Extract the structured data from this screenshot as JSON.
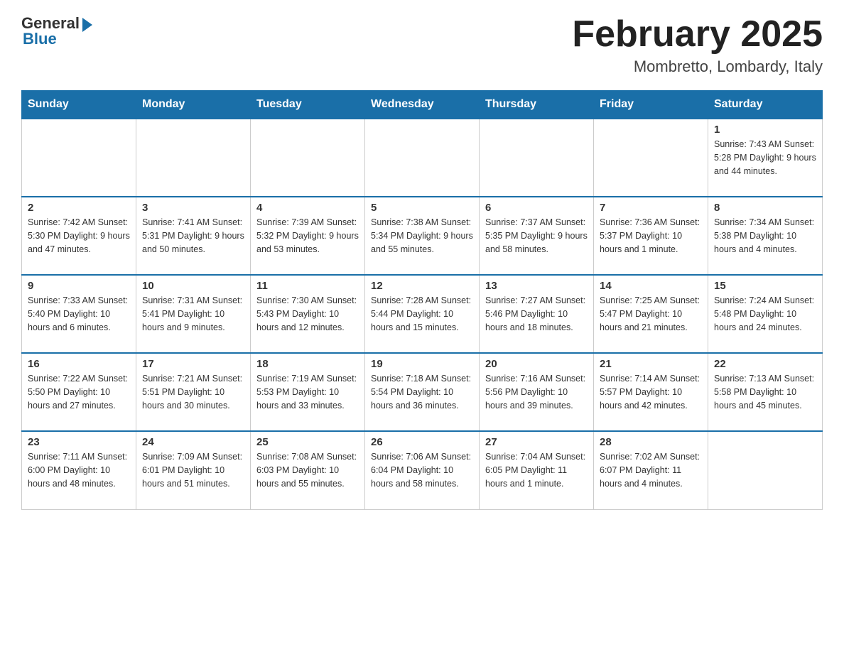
{
  "logo": {
    "general": "General",
    "blue": "Blue"
  },
  "title": "February 2025",
  "location": "Mombretto, Lombardy, Italy",
  "days_of_week": [
    "Sunday",
    "Monday",
    "Tuesday",
    "Wednesday",
    "Thursday",
    "Friday",
    "Saturday"
  ],
  "weeks": [
    [
      {
        "day": "",
        "info": ""
      },
      {
        "day": "",
        "info": ""
      },
      {
        "day": "",
        "info": ""
      },
      {
        "day": "",
        "info": ""
      },
      {
        "day": "",
        "info": ""
      },
      {
        "day": "",
        "info": ""
      },
      {
        "day": "1",
        "info": "Sunrise: 7:43 AM\nSunset: 5:28 PM\nDaylight: 9 hours and 44 minutes."
      }
    ],
    [
      {
        "day": "2",
        "info": "Sunrise: 7:42 AM\nSunset: 5:30 PM\nDaylight: 9 hours and 47 minutes."
      },
      {
        "day": "3",
        "info": "Sunrise: 7:41 AM\nSunset: 5:31 PM\nDaylight: 9 hours and 50 minutes."
      },
      {
        "day": "4",
        "info": "Sunrise: 7:39 AM\nSunset: 5:32 PM\nDaylight: 9 hours and 53 minutes."
      },
      {
        "day": "5",
        "info": "Sunrise: 7:38 AM\nSunset: 5:34 PM\nDaylight: 9 hours and 55 minutes."
      },
      {
        "day": "6",
        "info": "Sunrise: 7:37 AM\nSunset: 5:35 PM\nDaylight: 9 hours and 58 minutes."
      },
      {
        "day": "7",
        "info": "Sunrise: 7:36 AM\nSunset: 5:37 PM\nDaylight: 10 hours and 1 minute."
      },
      {
        "day": "8",
        "info": "Sunrise: 7:34 AM\nSunset: 5:38 PM\nDaylight: 10 hours and 4 minutes."
      }
    ],
    [
      {
        "day": "9",
        "info": "Sunrise: 7:33 AM\nSunset: 5:40 PM\nDaylight: 10 hours and 6 minutes."
      },
      {
        "day": "10",
        "info": "Sunrise: 7:31 AM\nSunset: 5:41 PM\nDaylight: 10 hours and 9 minutes."
      },
      {
        "day": "11",
        "info": "Sunrise: 7:30 AM\nSunset: 5:43 PM\nDaylight: 10 hours and 12 minutes."
      },
      {
        "day": "12",
        "info": "Sunrise: 7:28 AM\nSunset: 5:44 PM\nDaylight: 10 hours and 15 minutes."
      },
      {
        "day": "13",
        "info": "Sunrise: 7:27 AM\nSunset: 5:46 PM\nDaylight: 10 hours and 18 minutes."
      },
      {
        "day": "14",
        "info": "Sunrise: 7:25 AM\nSunset: 5:47 PM\nDaylight: 10 hours and 21 minutes."
      },
      {
        "day": "15",
        "info": "Sunrise: 7:24 AM\nSunset: 5:48 PM\nDaylight: 10 hours and 24 minutes."
      }
    ],
    [
      {
        "day": "16",
        "info": "Sunrise: 7:22 AM\nSunset: 5:50 PM\nDaylight: 10 hours and 27 minutes."
      },
      {
        "day": "17",
        "info": "Sunrise: 7:21 AM\nSunset: 5:51 PM\nDaylight: 10 hours and 30 minutes."
      },
      {
        "day": "18",
        "info": "Sunrise: 7:19 AM\nSunset: 5:53 PM\nDaylight: 10 hours and 33 minutes."
      },
      {
        "day": "19",
        "info": "Sunrise: 7:18 AM\nSunset: 5:54 PM\nDaylight: 10 hours and 36 minutes."
      },
      {
        "day": "20",
        "info": "Sunrise: 7:16 AM\nSunset: 5:56 PM\nDaylight: 10 hours and 39 minutes."
      },
      {
        "day": "21",
        "info": "Sunrise: 7:14 AM\nSunset: 5:57 PM\nDaylight: 10 hours and 42 minutes."
      },
      {
        "day": "22",
        "info": "Sunrise: 7:13 AM\nSunset: 5:58 PM\nDaylight: 10 hours and 45 minutes."
      }
    ],
    [
      {
        "day": "23",
        "info": "Sunrise: 7:11 AM\nSunset: 6:00 PM\nDaylight: 10 hours and 48 minutes."
      },
      {
        "day": "24",
        "info": "Sunrise: 7:09 AM\nSunset: 6:01 PM\nDaylight: 10 hours and 51 minutes."
      },
      {
        "day": "25",
        "info": "Sunrise: 7:08 AM\nSunset: 6:03 PM\nDaylight: 10 hours and 55 minutes."
      },
      {
        "day": "26",
        "info": "Sunrise: 7:06 AM\nSunset: 6:04 PM\nDaylight: 10 hours and 58 minutes."
      },
      {
        "day": "27",
        "info": "Sunrise: 7:04 AM\nSunset: 6:05 PM\nDaylight: 11 hours and 1 minute."
      },
      {
        "day": "28",
        "info": "Sunrise: 7:02 AM\nSunset: 6:07 PM\nDaylight: 11 hours and 4 minutes."
      },
      {
        "day": "",
        "info": ""
      }
    ]
  ]
}
